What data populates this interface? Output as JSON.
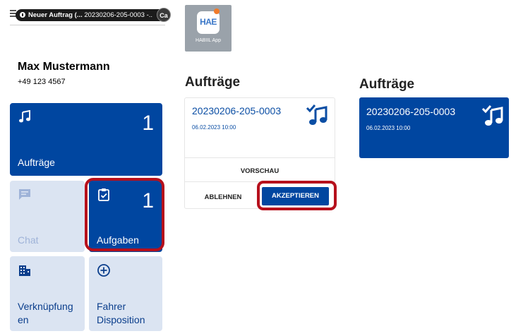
{
  "notification": {
    "title": "Neuer Auftrag (...",
    "subtitle": "20230206-205-0003 -..",
    "avatar_initials": "Ca"
  },
  "app": {
    "icon_logo": "HAE",
    "icon_label": "HABIIL App"
  },
  "user": {
    "name": "Max Mustermann",
    "phone": "+49 123 4567"
  },
  "tiles": {
    "auftraege": {
      "label": "Aufträge",
      "count": "1"
    },
    "chat": {
      "label": "Chat"
    },
    "aufgaben": {
      "label": "Aufgaben",
      "count": "1"
    },
    "verknuepfungen": {
      "label_line1": "Verknüpfung",
      "label_line2": "en"
    },
    "fahrer": {
      "label_line1": "Fahrer",
      "label_line2": "Disposition"
    }
  },
  "orders_before": {
    "title": "Aufträge",
    "order": {
      "number": "20230206-205-0003",
      "date": "06.02.2023 10:00",
      "preview_label": "VORSCHAU",
      "reject_label": "ABLEHNEN",
      "accept_label": "AKZEPTIEREN"
    }
  },
  "orders_after": {
    "title": "Aufträge",
    "order": {
      "number": "20230206-205-0003",
      "date": "06.02.2023 10:00"
    }
  },
  "colors": {
    "primary": "#0046a0",
    "tile_light": "#dbe4f2",
    "highlight": "#b6101c"
  },
  "icons": [
    "menu-icon",
    "info-icon",
    "music-note-icon",
    "chat-icon",
    "task-checklist-icon",
    "building-icon",
    "add-circle-icon",
    "order-status-icon"
  ]
}
